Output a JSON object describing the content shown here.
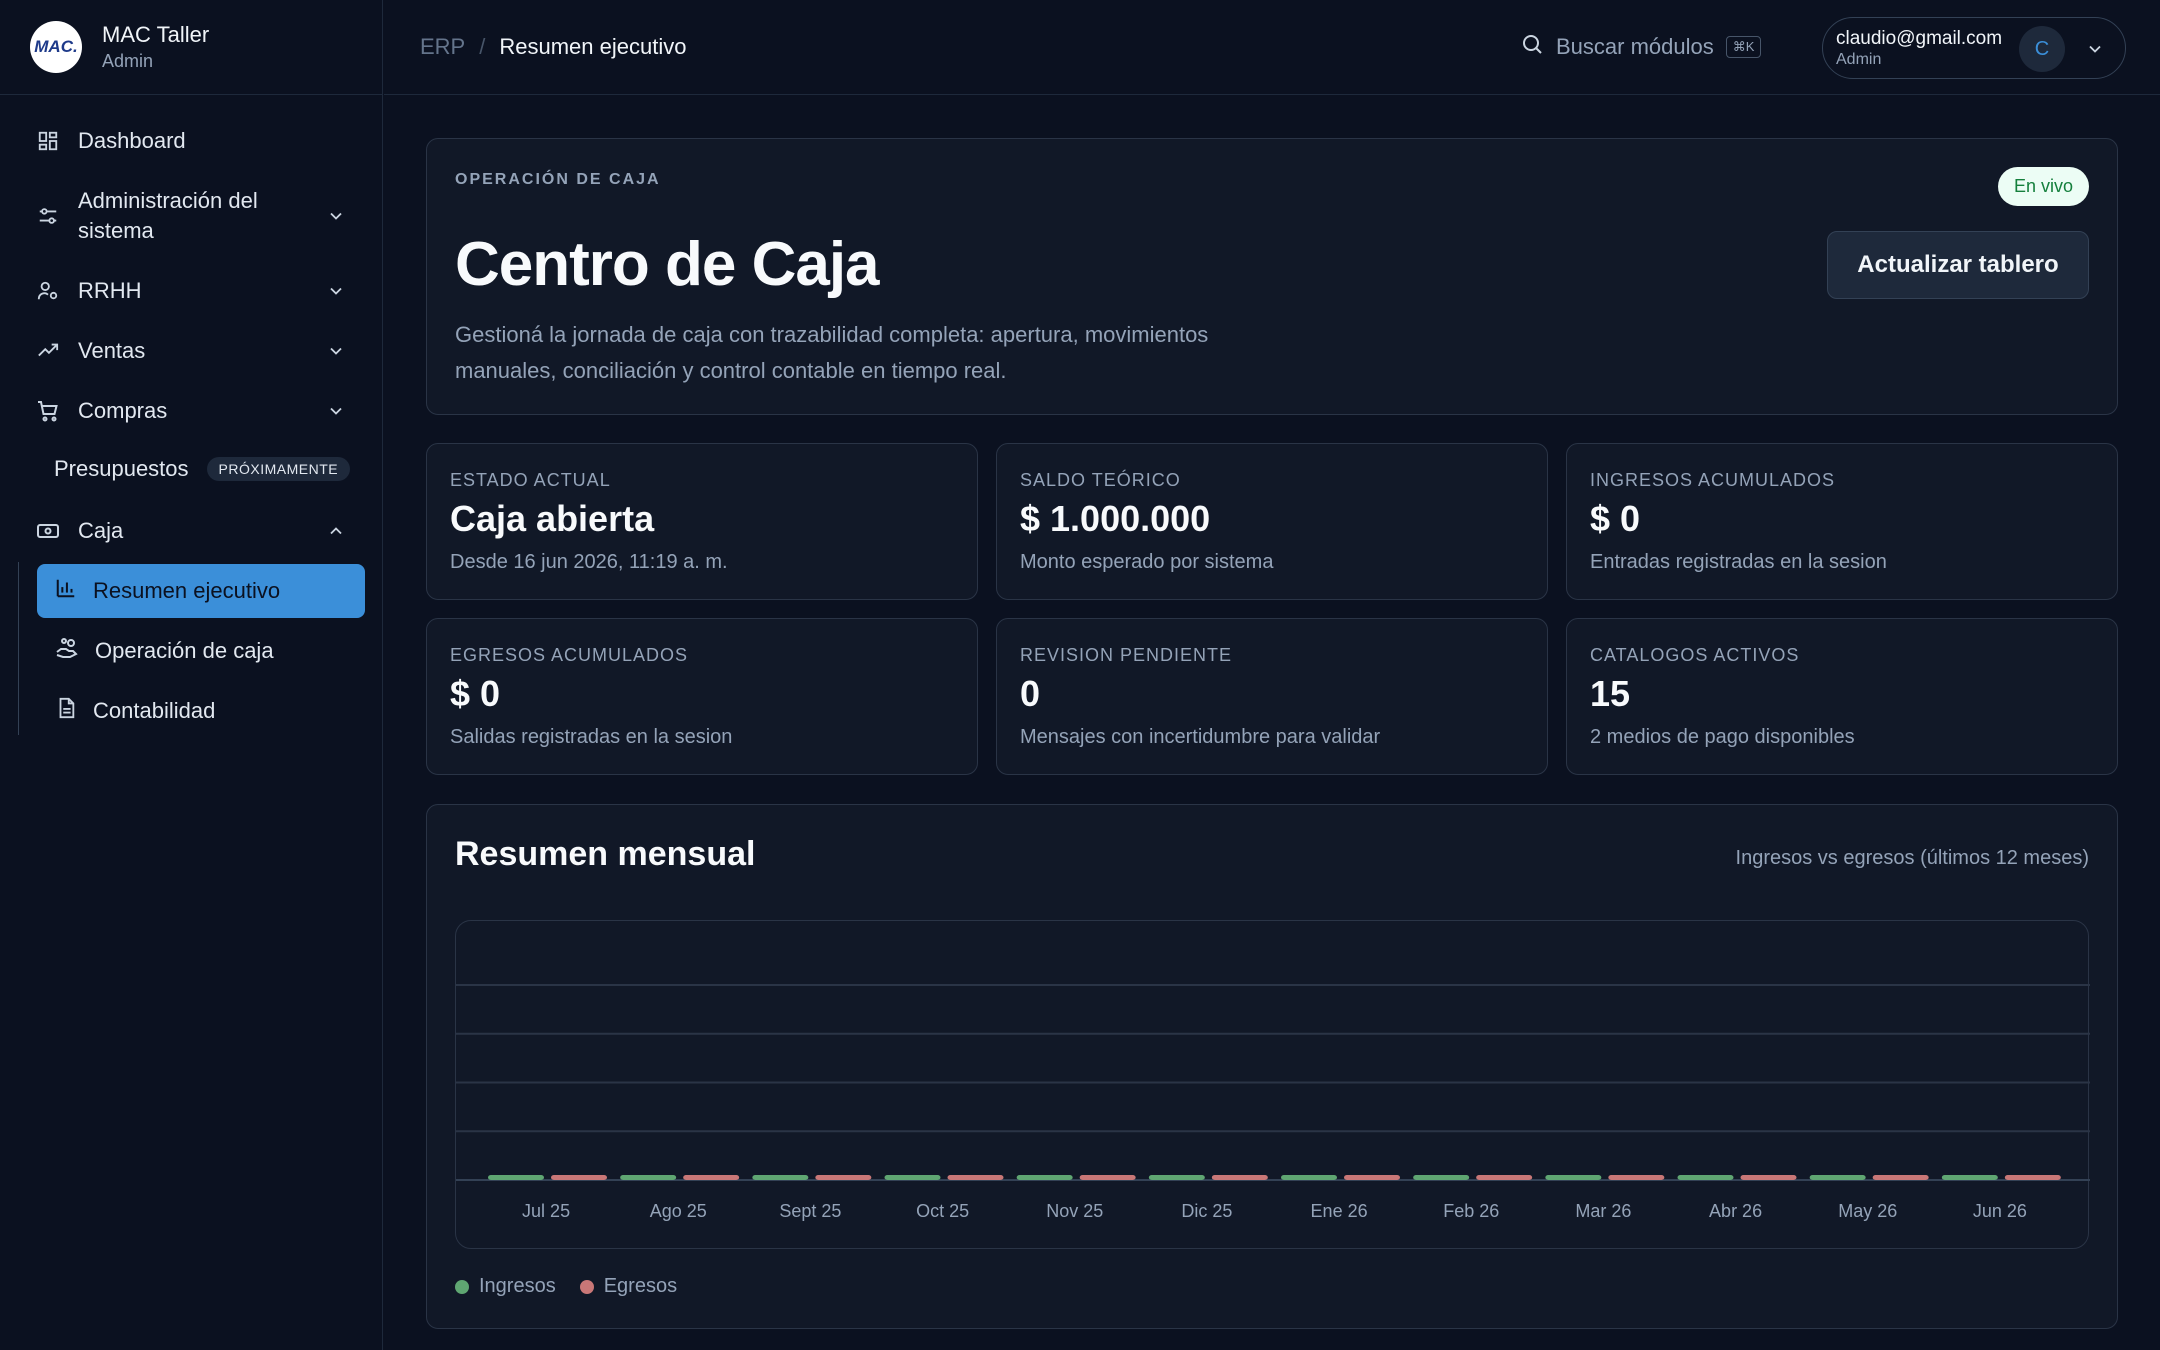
{
  "brand": {
    "logo_text": "MAC.",
    "name": "MAC Taller",
    "role": "Admin"
  },
  "sidebar": {
    "items": [
      {
        "label": "Dashboard"
      },
      {
        "label": "Administración del sistema"
      },
      {
        "label": "RRHH"
      },
      {
        "label": "Ventas"
      },
      {
        "label": "Compras"
      },
      {
        "label": "Presupuestos",
        "badge": "PRÓXIMAMENTE"
      },
      {
        "label": "Caja"
      }
    ],
    "caja_sub": [
      {
        "label": "Resumen ejecutivo",
        "active": true
      },
      {
        "label": "Operación de caja"
      },
      {
        "label": "Contabilidad"
      }
    ]
  },
  "topbar": {
    "crumb_root": "ERP",
    "crumb_sep": "/",
    "crumb_current": "Resumen ejecutivo",
    "search_label": "Buscar módulos",
    "search_kbd": "⌘K",
    "user_email": "claudio@gmail.com",
    "user_role": "Admin",
    "avatar_initial": "C"
  },
  "hero": {
    "eyebrow": "OPERACIÓN DE CAJA",
    "badge": "En vivo",
    "title": "Centro de Caja",
    "description": "Gestioná la jornada de caja con trazabilidad completa: apertura, movimientos manuales, conciliación y control contable en tiempo real.",
    "refresh_label": "Actualizar tablero"
  },
  "stats": [
    {
      "label": "ESTADO ACTUAL",
      "value": "Caja abierta",
      "sub": "Desde 16 jun 2026, 11:19 a. m."
    },
    {
      "label": "SALDO TEÓRICO",
      "value": "$ 1.000.000",
      "sub": "Monto esperado por sistema"
    },
    {
      "label": "INGRESOS ACUMULADOS",
      "value": "$ 0",
      "sub": "Entradas registradas en la sesion"
    },
    {
      "label": "EGRESOS ACUMULADOS",
      "value": "$ 0",
      "sub": "Salidas registradas en la sesion"
    },
    {
      "label": "REVISION PENDIENTE",
      "value": "0",
      "sub": "Mensajes con incertidumbre para validar"
    },
    {
      "label": "CATALOGOS ACTIVOS",
      "value": "15",
      "sub": "2 medios de pago disponibles"
    }
  ],
  "chart_section": {
    "title": "Resumen mensual",
    "note": "Ingresos vs egresos (últimos 12 meses)"
  },
  "colors": {
    "ingresos": "#5fa672",
    "egresos": "#c97777",
    "accent": "#3b8fd9"
  },
  "chart_data": {
    "type": "bar",
    "categories": [
      "Jul 25",
      "Ago 25",
      "Sept 25",
      "Oct 25",
      "Nov 25",
      "Dic 25",
      "Ene 26",
      "Feb 26",
      "Mar 26",
      "Abr 26",
      "May 26",
      "Jun 26"
    ],
    "series": [
      {
        "name": "Ingresos",
        "values": [
          0,
          0,
          0,
          0,
          0,
          0,
          0,
          0,
          0,
          0,
          0,
          0
        ]
      },
      {
        "name": "Egresos",
        "values": [
          0,
          0,
          0,
          0,
          0,
          0,
          0,
          0,
          0,
          0,
          0,
          0
        ]
      }
    ],
    "grid": true,
    "legend": "bottom-left"
  }
}
